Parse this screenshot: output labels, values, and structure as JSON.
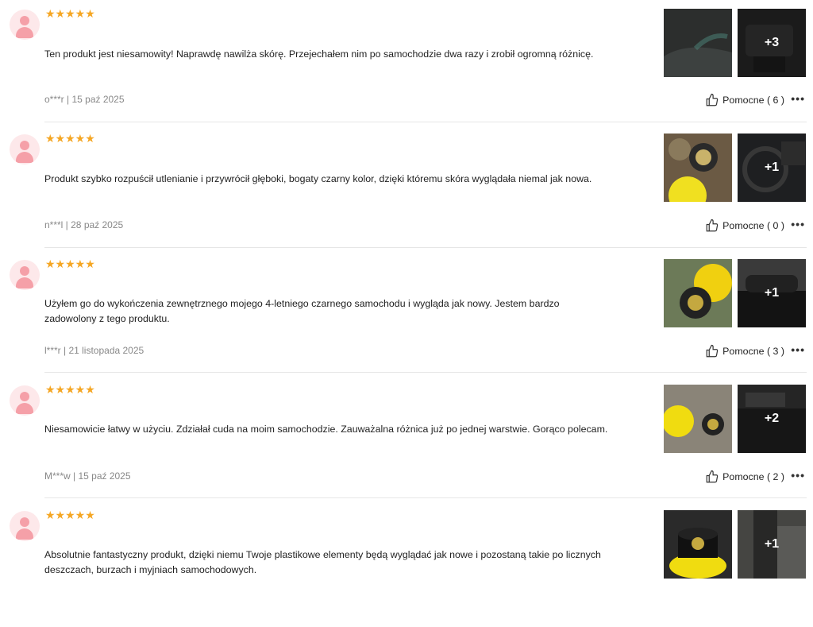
{
  "reviews": [
    {
      "stars": "★★★★★",
      "text": "Ten produkt jest niesamowity! Naprawdę nawilża skórę. Przejechałem nim po samochodzie dwa razy i zrobił ogromną różnicę.",
      "meta": "o***r | 15 paź 2025",
      "helpful": "Pomocne ( 6 )",
      "more_count": "+3"
    },
    {
      "stars": "★★★★★",
      "text": "Produkt szybko rozpuścił utlenianie i przywrócił głęboki, bogaty czarny kolor, dzięki któremu skóra wyglądała niemal jak nowa.",
      "meta": "n***l | 28 paź 2025",
      "helpful": "Pomocne ( 0 )",
      "more_count": "+1"
    },
    {
      "stars": "★★★★★",
      "text": "Użyłem go do wykończenia zewnętrznego mojego 4-letniego czarnego samochodu i wygląda jak nowy. Jestem bardzo zadowolony z tego produktu.",
      "meta": "l***r | 21 listopada 2025",
      "helpful": "Pomocne ( 3 )",
      "more_count": "+1"
    },
    {
      "stars": "★★★★★",
      "text": "Niesamowicie łatwy w użyciu. Zdziałał cuda na moim samochodzie. Zauważalna różnica już po jednej warstwie. Gorąco polecam.",
      "meta": "M***w | 15 paź 2025",
      "helpful": "Pomocne ( 2 )",
      "more_count": "+2"
    },
    {
      "stars": "★★★★★",
      "text": "Absolutnie fantastyczny produkt, dzięki niemu Twoje plastikowe elementy będą wyglądać jak nowe i pozostaną takie po licznych deszczach, burzach i myjniach samochodowych.",
      "meta": "",
      "helpful": "",
      "more_count": "+1"
    }
  ],
  "more_icon": "•••",
  "colors": {
    "star": "#f5a623",
    "meta": "#888888",
    "divider": "#e6e6e6",
    "avatar_bg": "#fde8ea",
    "avatar_fg": "#f5a0a8"
  }
}
